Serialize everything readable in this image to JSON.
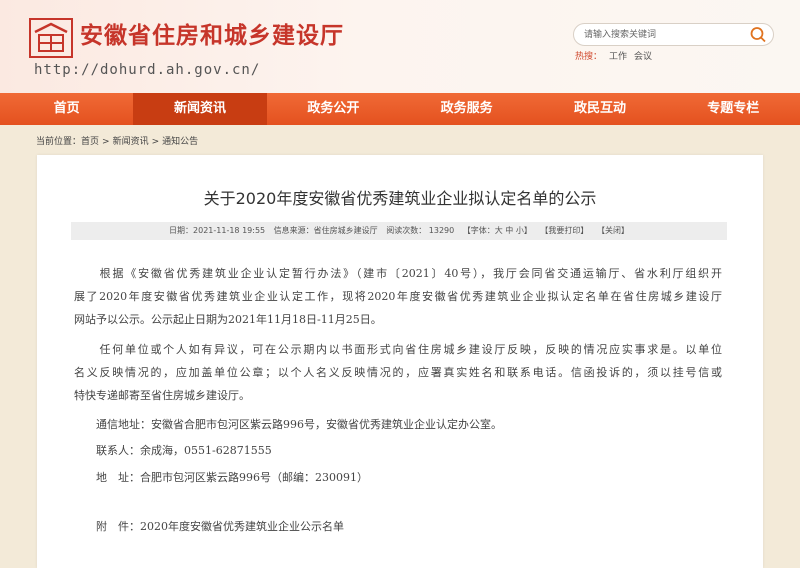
{
  "header": {
    "site_title": "安徽省住房和城乡建设厅",
    "site_url": "http://dohurd.ah.gov.cn/",
    "search_placeholder": "请输入搜索关键词",
    "hot_label": "热搜：",
    "hot_keywords": [
      "工作",
      "会议"
    ]
  },
  "nav": {
    "items": [
      "首页",
      "新闻资讯",
      "政务公开",
      "政务服务",
      "政民互动",
      "专题专栏"
    ],
    "active_index": 1
  },
  "breadcrumb": {
    "label": "当前位置：",
    "items": [
      "首页",
      "新闻资讯",
      "通知公告"
    ]
  },
  "article": {
    "title": "关于2020年度安徽省优秀建筑业企业拟认定名单的公示",
    "meta": {
      "date": "日期：2021-11-18 19:55",
      "source": "信息来源：省住房城乡建设厅",
      "views": "阅读次数： 13290",
      "font_size": "【字体：大 中 小】",
      "print": "【我要打印】",
      "close": "【关闭】"
    },
    "lines": [
      "　　根据《安徽省优秀建筑业企业认定暂行办法》（建市〔2021〕40号），我厅会同省交通运输厅、省水利厅组织开",
      "展了2020年度安徽省优秀建筑业企业认定工作，现将2020年度安徽省优秀建筑业企业拟认定名单在省住房城乡建设厅",
      "网站予以公示。公示起止日期为2021年11月18日-11月25日。",
      "　　任何单位或个人如有异议，可在公示期内以书面形式向省住房城乡建设厅反映，反映的情况应实事求是。以单位",
      "名义反映情况的，应加盖单位公章；以个人名义反映情况的，应署真实姓名和联系电话。信函投诉的，须以挂号信或",
      "特快专递邮寄至省住房城乡建设厅。",
      "　　通信地址：安徽省合肥市包河区紫云路996号，安徽省优秀建筑业企业认定办公室。",
      "　　联系人：余成海，0551-62871555",
      "　　地　址：合肥市包河区紫云路996号（邮编：230091）",
      "",
      "　　附　件：2020年度安徽省优秀建筑业企业公示名单"
    ]
  },
  "colors": {
    "brand_red": "#c6352a",
    "nav_orange": "#e85a24",
    "nav_active": "#c83d12",
    "page_bg": "#f3ead8"
  }
}
